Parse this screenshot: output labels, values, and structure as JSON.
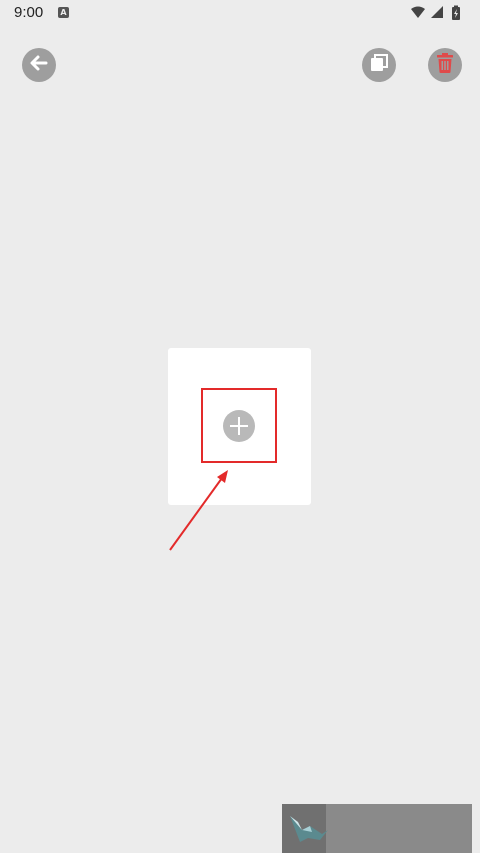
{
  "status_bar": {
    "time": "9:00",
    "notification_glyph": "A",
    "icons": [
      "wifi-icon",
      "signal-icon",
      "battery-charging-icon"
    ]
  },
  "toolbar": {
    "back_icon": "back-arrow-icon",
    "copy_icon": "copy-icon",
    "delete_icon": "trash-icon",
    "accent_color": "#e32a2a",
    "button_color": "#9e9e9e"
  },
  "main": {
    "card": {
      "add_icon": "plus-icon"
    },
    "annotation": {
      "highlight_color": "#e32a2a"
    }
  },
  "thumbnail": {
    "icon": "bird-image"
  }
}
